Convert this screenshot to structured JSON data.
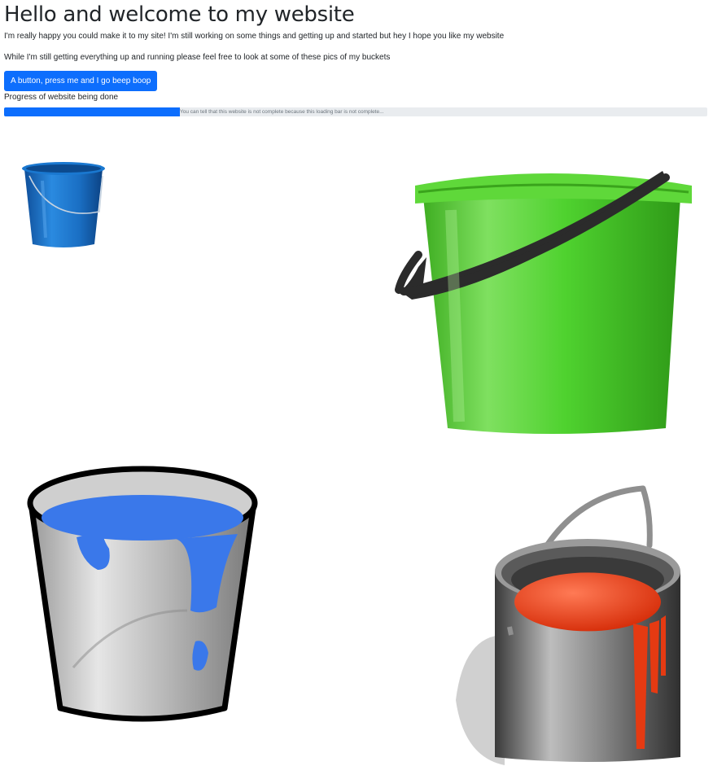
{
  "header": {
    "title": "Hello and welcome to my website",
    "intro": "I'm really happy you could make it to my site! I'm still working on some things and getting up and started but hey I hope you like my website",
    "buckets_note": "While I'm still getting everything up and running please feel free to look at some of these pics of my buckets"
  },
  "button": {
    "label": "A button, press me and I go beep boop"
  },
  "progress": {
    "label": "Progress of website being done",
    "fraction": 0.25,
    "bar_text": "You can tell that this website is not complete because this loading bar is not complete..."
  },
  "colors": {
    "primary": "#0d6efd",
    "progress_track": "#e9ecef",
    "blue_bucket": "#1573c9",
    "green_bucket": "#4ccf2c",
    "water": "#3a78ea",
    "paint": "#e53a12"
  },
  "images": [
    {
      "name": "blue-bucket"
    },
    {
      "name": "green-bucket"
    },
    {
      "name": "water-bucket"
    },
    {
      "name": "paint-bucket"
    }
  ]
}
